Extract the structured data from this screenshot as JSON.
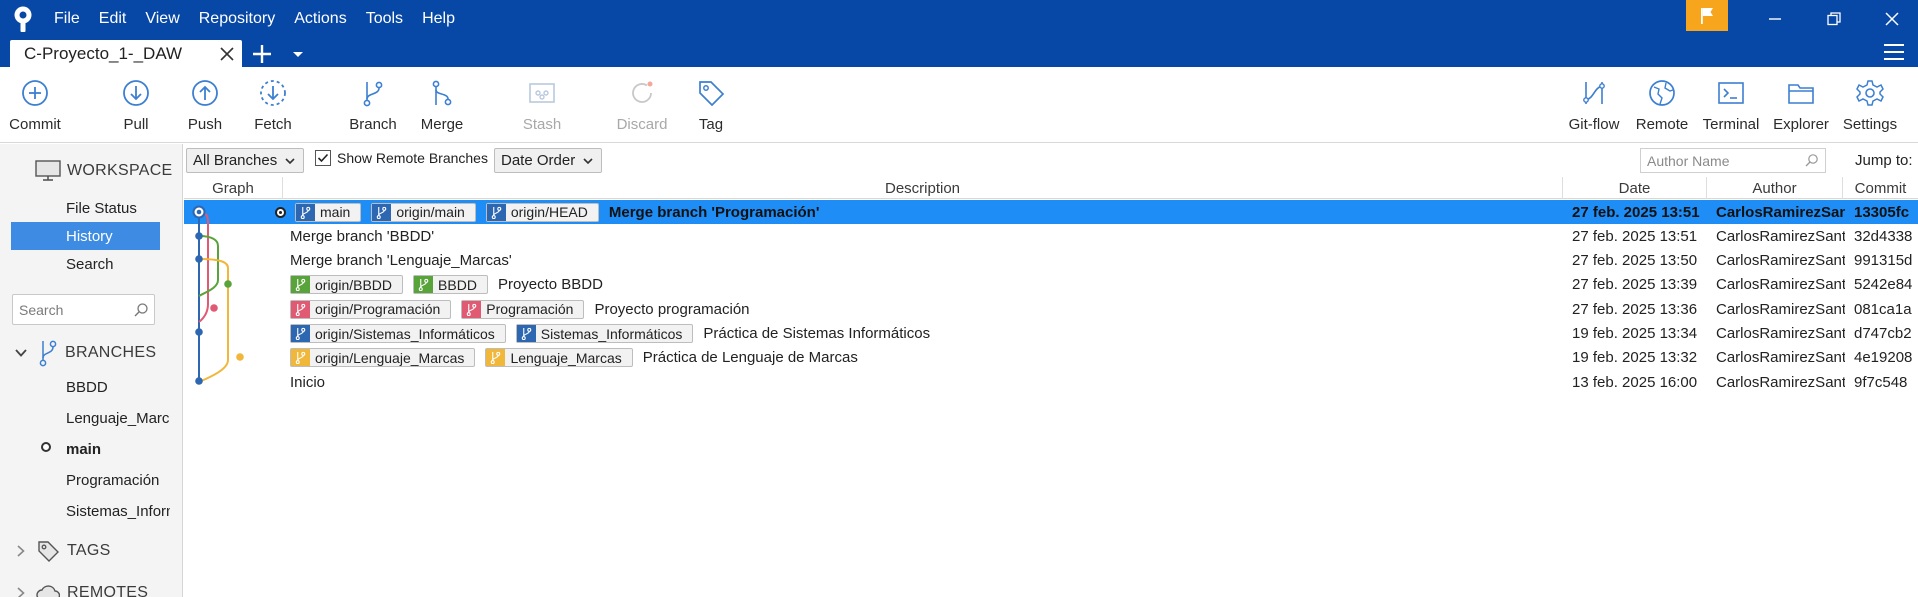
{
  "window": {
    "menu": [
      "File",
      "Edit",
      "View",
      "Repository",
      "Actions",
      "Tools",
      "Help"
    ],
    "accent_color": "#0747a6",
    "flag_color": "#f6a51d",
    "icons": [
      "sourcetree-logo",
      "flag-icon",
      "minimize-icon",
      "restore-icon",
      "close-icon"
    ]
  },
  "tabs": {
    "repo_tab_label": "C-Proyecto_1-_DAW",
    "icons": [
      "tab-close-icon",
      "add-tab-icon",
      "tab-dropdown-icon",
      "hamburger-menu-icon"
    ]
  },
  "toolbar": {
    "commit": "Commit",
    "pull": "Pull",
    "push": "Push",
    "fetch": "Fetch",
    "branch": "Branch",
    "merge": "Merge",
    "stash": "Stash",
    "discard": "Discard",
    "tag": "Tag",
    "gitflow": "Git-flow",
    "remote": "Remote",
    "terminal": "Terminal",
    "explorer": "Explorer",
    "settings": "Settings",
    "disabled": [
      "Stash",
      "Discard"
    ]
  },
  "sidebar": {
    "workspace_label": "WORKSPACE",
    "workspace_items": [
      "File Status",
      "History",
      "Search"
    ],
    "selected_item": "History",
    "search_placeholder": "Search",
    "branches_label": "BRANCHES",
    "branches": [
      "BBDD",
      "Lenguaje_Marca",
      "main",
      "Programación",
      "Sistemas_Inform"
    ],
    "current_branch": "main",
    "tags_label": "TAGS",
    "remotes_label": "REMOTES"
  },
  "filter": {
    "branches_filter": "All Branches",
    "show_remote_label": "Show Remote Branches",
    "show_remote_checked": true,
    "order": "Date Order",
    "author_placeholder": "Author Name",
    "jump_to": "Jump to:"
  },
  "columns": {
    "graph": "Graph",
    "description": "Description",
    "date": "Date",
    "author": "Author",
    "commit": "Commit"
  },
  "commits": [
    {
      "refs": [
        {
          "name": "main",
          "color": "#2d67b2"
        },
        {
          "name": "origin/main",
          "color": "#2d67b2"
        },
        {
          "name": "origin/HEAD",
          "color": "#2d67b2"
        }
      ],
      "message": "Merge branch 'Programación'",
      "date": "27 feb. 2025 13:51",
      "author": "CarlosRamirezSan",
      "hash": "13305fc",
      "head": true
    },
    {
      "refs": [],
      "message": "Merge branch 'BBDD'",
      "date": "27 feb. 2025 13:51",
      "author": "CarlosRamirezSant",
      "hash": "32d4338"
    },
    {
      "refs": [],
      "message": "Merge branch 'Lenguaje_Marcas'",
      "date": "27 feb. 2025 13:50",
      "author": "CarlosRamirezSant",
      "hash": "991315d"
    },
    {
      "refs": [
        {
          "name": "origin/BBDD",
          "color": "#59a33b"
        },
        {
          "name": "BBDD",
          "color": "#59a33b"
        }
      ],
      "message": "Proyecto BBDD",
      "date": "27 feb. 2025 13:39",
      "author": "CarlosRamirezSant",
      "hash": "5242e84"
    },
    {
      "refs": [
        {
          "name": "origin/Programación",
          "color": "#e05a73"
        },
        {
          "name": "Programación",
          "color": "#e05a73"
        }
      ],
      "message": "Proyecto programación",
      "date": "27 feb. 2025 13:36",
      "author": "CarlosRamirezSant",
      "hash": "081ca1a"
    },
    {
      "refs": [
        {
          "name": "origin/Sistemas_Informáticos",
          "color": "#2d67b2"
        },
        {
          "name": "Sistemas_Informáticos",
          "color": "#2d67b2"
        }
      ],
      "message": "Práctica de Sistemas Informáticos",
      "date": "19 feb. 2025 13:34",
      "author": "CarlosRamirezSant",
      "hash": "d747cb2"
    },
    {
      "refs": [
        {
          "name": "origin/Lenguaje_Marcas",
          "color": "#f0b73a"
        },
        {
          "name": "Lenguaje_Marcas",
          "color": "#f0b73a"
        }
      ],
      "message": "Práctica de Lenguaje de Marcas",
      "date": "19 feb. 2025 13:32",
      "author": "CarlosRamirezSant",
      "hash": "4e19208"
    },
    {
      "refs": [],
      "message": "Inicio",
      "date": "13 feb. 2025 16:00",
      "author": "CarlosRamirezSant",
      "hash": "9f7c548"
    }
  ],
  "selection_color": "#1e8df5"
}
